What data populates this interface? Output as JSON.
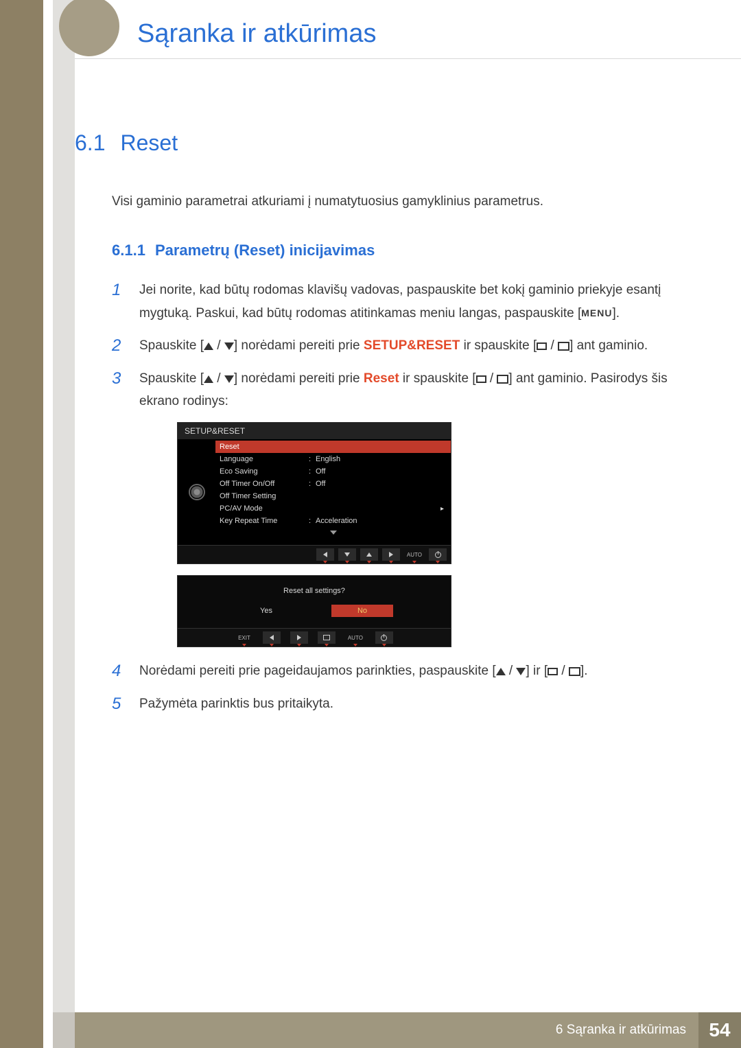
{
  "header": {
    "chapter_title": "Sąranka ir atkūrimas"
  },
  "section": {
    "number": "6.1",
    "title": "Reset",
    "intro": "Visi gaminio parametrai atkuriami į numatytuosius gamyklinius parametrus."
  },
  "subsection": {
    "number": "6.1.1",
    "title": "Parametrų (Reset) inicijavimas"
  },
  "steps": {
    "s1_num": "1",
    "s1": "Jei norite, kad būtų rodomas klavišų vadovas, paspauskite bet kokį gaminio priekyje esantį mygtuką. Paskui, kad būtų rodomas atitinkamas meniu langas, paspauskite [",
    "s1_menu": "MENU",
    "s1_end": "].",
    "s2_num": "2",
    "s2_a": "Spauskite [",
    "s2_b": "] norėdami pereiti prie ",
    "s2_red": "SETUP&RESET",
    "s2_c": " ir spauskite [",
    "s2_d": "] ant gaminio.",
    "s3_num": "3",
    "s3_a": "Spauskite [",
    "s3_b": "] norėdami pereiti prie ",
    "s3_red": "Reset",
    "s3_c": " ir spauskite [",
    "s3_d": "] ant gaminio. Pasirodys šis ekrano rodinys:",
    "s4_num": "4",
    "s4_a": "Norėdami pereiti prie pageidaujamos parinkties, paspauskite [",
    "s4_b": "] ir [",
    "s4_c": "].",
    "s5_num": "5",
    "s5": "Pažymėta parinktis bus pritaikyta."
  },
  "osd": {
    "title": "SETUP&RESET",
    "rows": [
      {
        "k": "Reset",
        "v": "",
        "sel": true
      },
      {
        "k": "Language",
        "v": "English"
      },
      {
        "k": "Eco Saving",
        "v": "Off"
      },
      {
        "k": "Off Timer On/Off",
        "v": "Off"
      },
      {
        "k": "Off Timer Setting",
        "v": ""
      },
      {
        "k": "PC/AV Mode",
        "v": "",
        "arrow": true
      },
      {
        "k": "Key Repeat Time",
        "v": "Acceleration"
      }
    ],
    "ctrl_auto": "AUTO"
  },
  "dialog": {
    "question": "Reset all settings?",
    "yes": "Yes",
    "no": "No",
    "exit": "EXIT",
    "auto": "AUTO"
  },
  "footer": {
    "text": "6 Sąranka ir atkūrimas",
    "page": "54"
  }
}
